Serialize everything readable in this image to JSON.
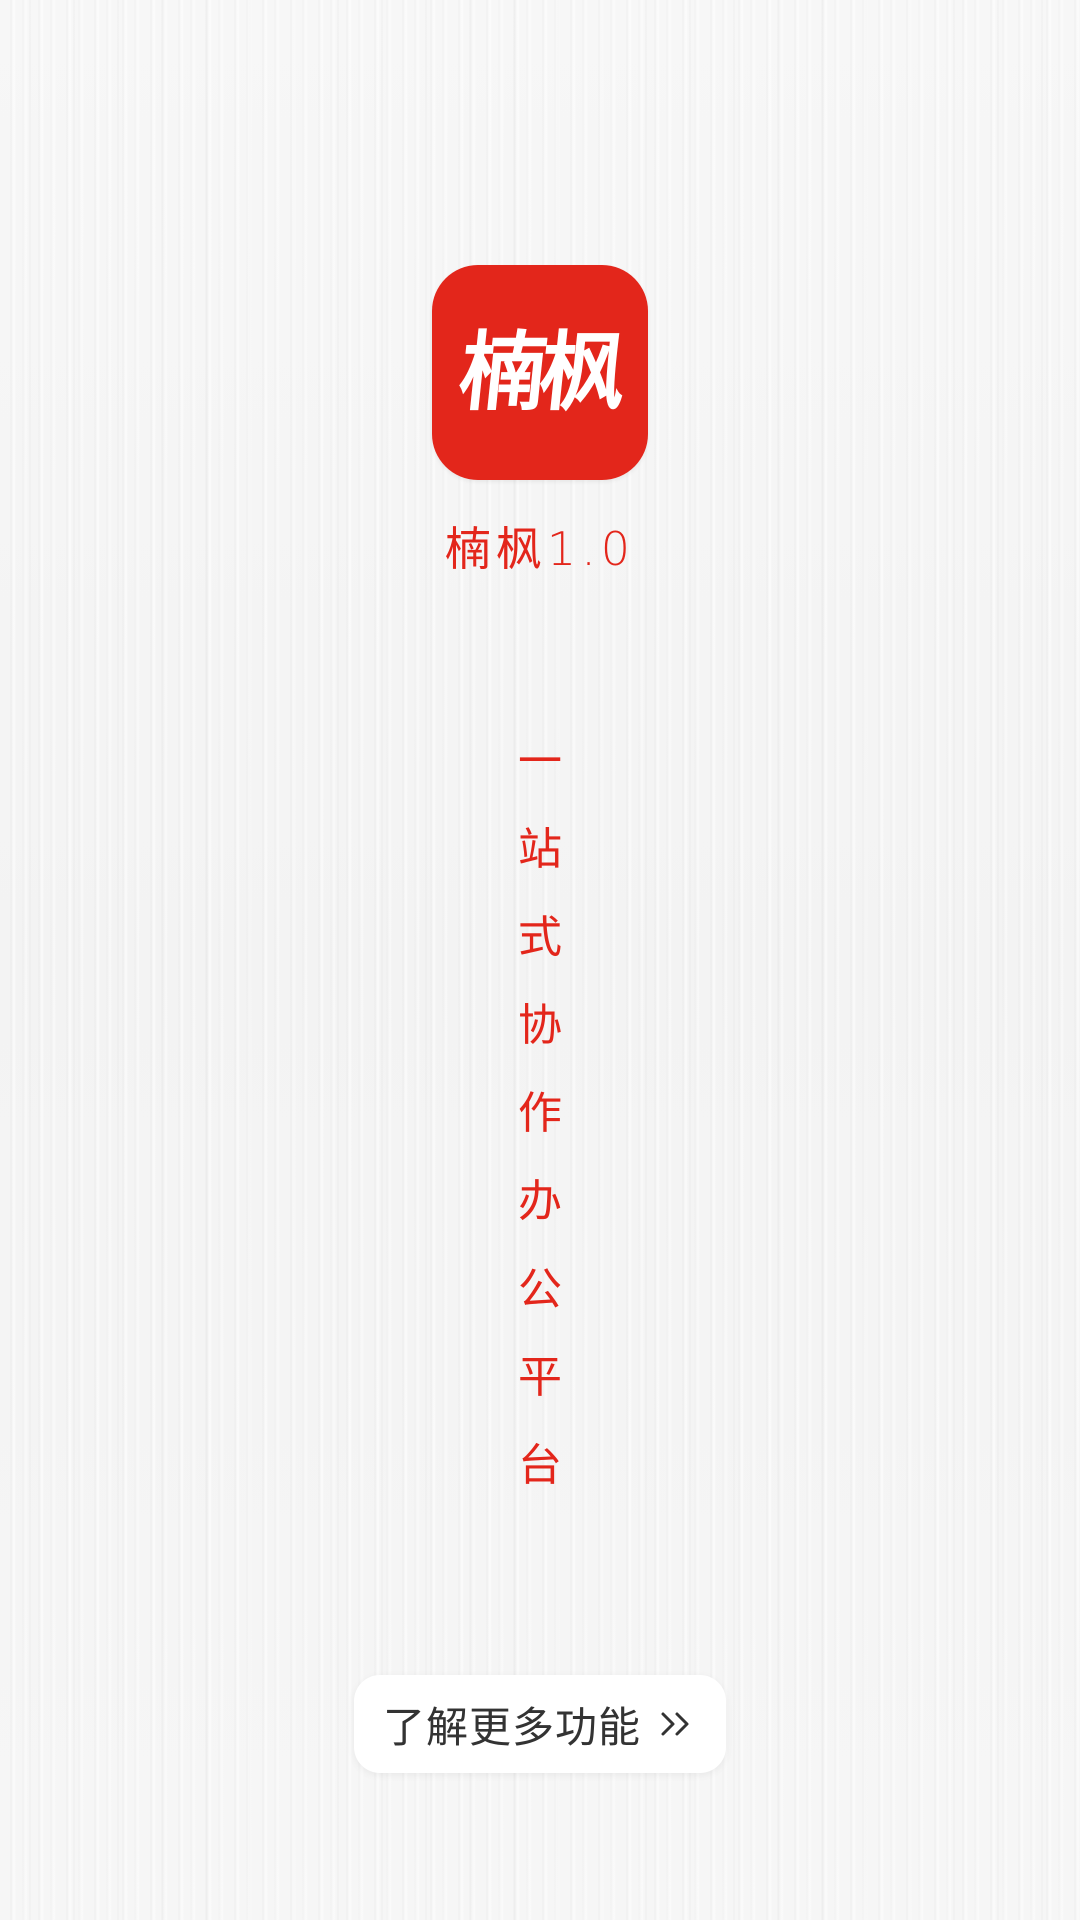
{
  "colors": {
    "brand_red": "#e3261b",
    "text_red": "#e3261b",
    "button_text": "#333333",
    "button_bg": "#ffffff"
  },
  "app": {
    "icon_text": "楠枫",
    "icon_name": "app-logo-icon",
    "title": "楠枫1.0"
  },
  "slogan": {
    "chars": [
      "一",
      "站",
      "式",
      "协",
      "作",
      "办",
      "公",
      "平",
      "台"
    ]
  },
  "cta": {
    "label": "了解更多功能",
    "icon": "double-chevron-right-icon"
  }
}
